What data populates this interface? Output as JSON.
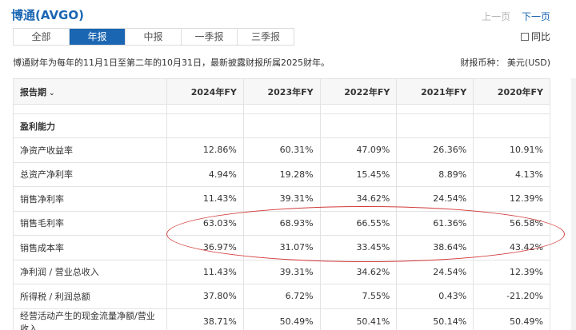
{
  "header": {
    "title": "博通(AVGO)",
    "prev_label": "上一页",
    "next_label": "下一页",
    "compare_label": "同比"
  },
  "tabs": [
    {
      "label": "全部"
    },
    {
      "label": "年报"
    },
    {
      "label": "中报"
    },
    {
      "label": "一季报"
    },
    {
      "label": "三季报"
    }
  ],
  "active_tab": "年报",
  "note": "博通财年为每年的11月1日至第二年的10月31日，最新披露财报所属2025财年。",
  "currency": "财报币种： 美元(USD)",
  "table": {
    "period_label": "报告期",
    "columns": [
      "2024年FY",
      "2023年FY",
      "2022年FY",
      "2021年FY",
      "2020年FY"
    ],
    "section": "盈利能力",
    "rows": [
      {
        "label": "净资产收益率",
        "values": [
          "12.86%",
          "60.31%",
          "47.09%",
          "26.36%",
          "10.91%"
        ]
      },
      {
        "label": "总资产净利率",
        "values": [
          "4.94%",
          "19.28%",
          "15.45%",
          "8.89%",
          "4.13%"
        ]
      },
      {
        "label": "销售净利率",
        "values": [
          "11.43%",
          "39.31%",
          "34.62%",
          "24.54%",
          "12.39%"
        ]
      },
      {
        "label": "销售毛利率",
        "values": [
          "63.03%",
          "68.93%",
          "66.55%",
          "61.36%",
          "56.58%"
        ]
      },
      {
        "label": "销售成本率",
        "values": [
          "36.97%",
          "31.07%",
          "33.45%",
          "38.64%",
          "43.42%"
        ]
      },
      {
        "label": "净利润 / 营业总收入",
        "values": [
          "11.43%",
          "39.31%",
          "34.62%",
          "24.54%",
          "12.39%"
        ]
      },
      {
        "label": "所得税 / 利润总额",
        "values": [
          "37.80%",
          "6.72%",
          "7.55%",
          "0.43%",
          "-21.20%"
        ]
      },
      {
        "label": "经营活动产生的现金流量净额/营业收入",
        "values": [
          "38.71%",
          "50.49%",
          "50.41%",
          "50.14%",
          "50.49%"
        ]
      }
    ]
  },
  "annotation_color": "#d23a3a",
  "accent_color": "#1a66b3"
}
